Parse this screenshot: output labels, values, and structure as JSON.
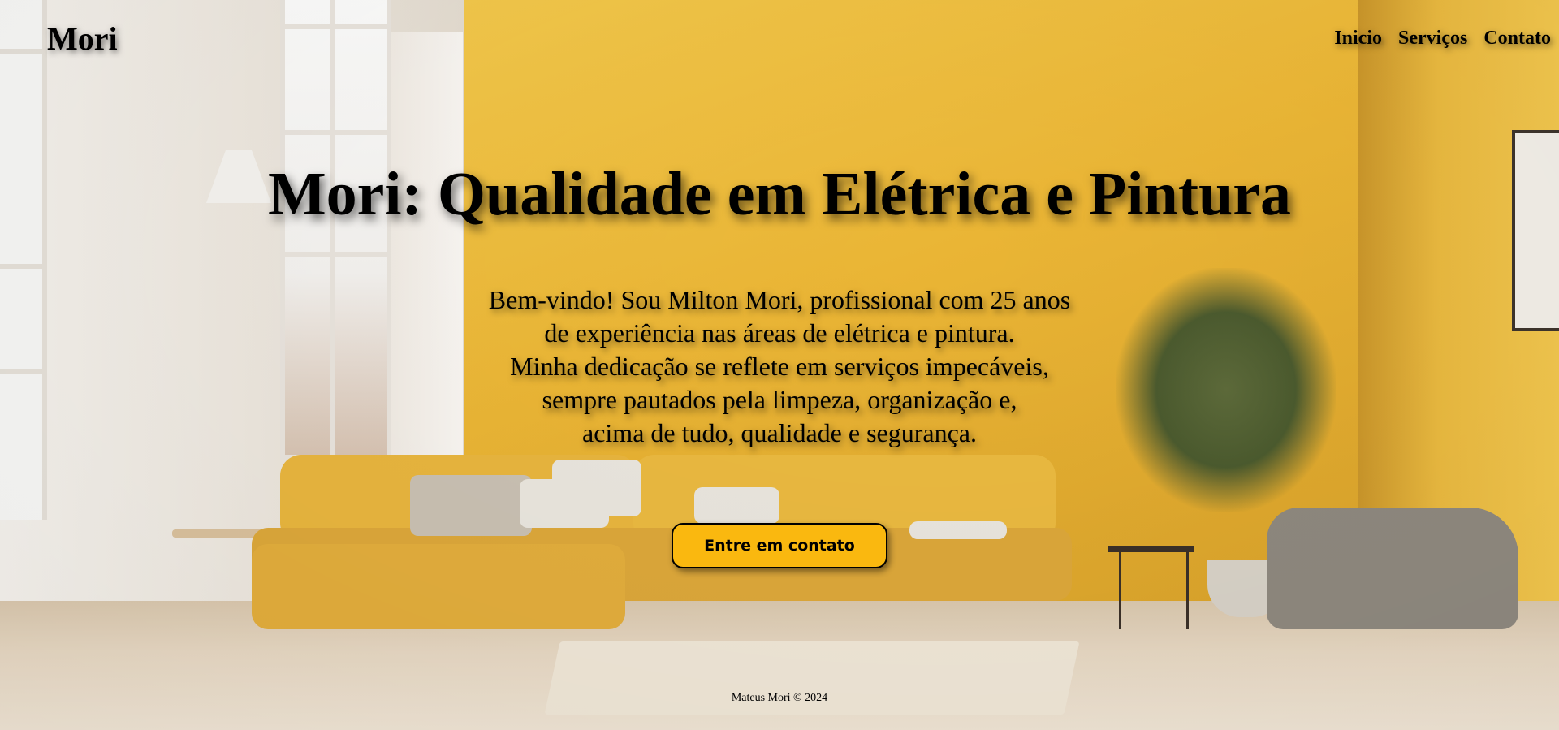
{
  "header": {
    "logo": "Mori",
    "nav": [
      {
        "label": "Inicio"
      },
      {
        "label": "Serviços"
      },
      {
        "label": "Contato"
      }
    ]
  },
  "hero": {
    "title": "Mori: Qualidade em Elétrica e Pintura",
    "lines": [
      "Bem-vindo! Sou Milton Mori, profissional com 25 anos",
      "de experiência nas áreas de elétrica e pintura.",
      "Minha dedicação se reflete em serviços impecáveis,",
      "sempre pautados pela limpeza, organização e,",
      "acima de tudo, qualidade e segurança."
    ],
    "cta_label": "Entre em contato"
  },
  "footer": {
    "text": "Mateus Mori © 2024"
  },
  "colors": {
    "accent": "#fab80f",
    "wall": "#eab535",
    "text": "#000000"
  }
}
